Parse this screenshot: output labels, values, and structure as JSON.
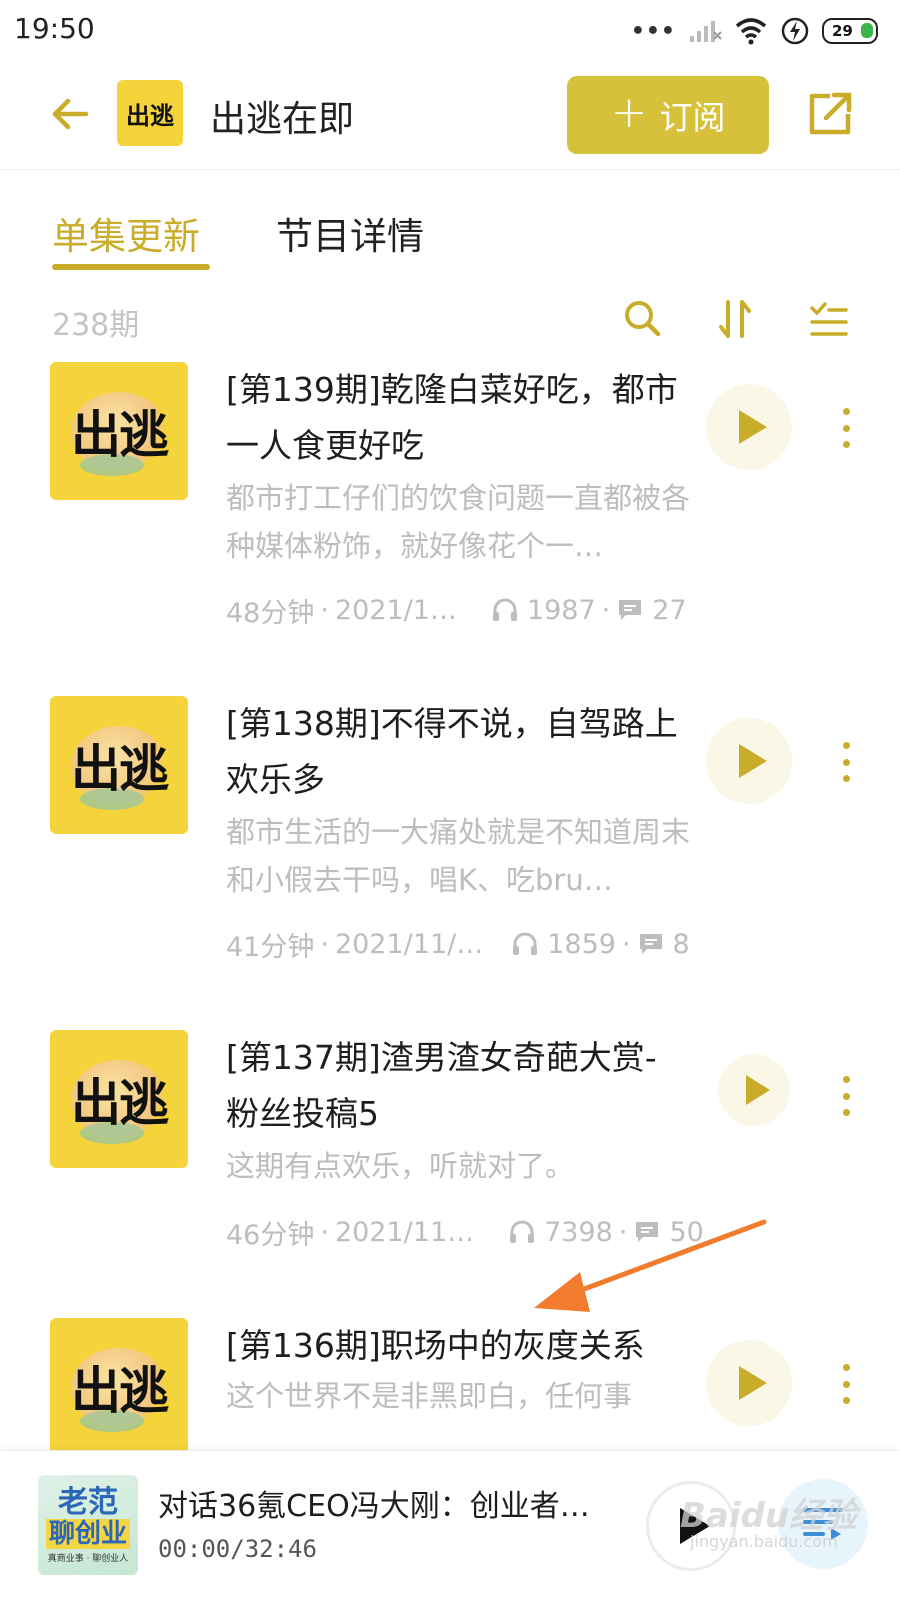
{
  "status_bar": {
    "time": "19:50",
    "signal_dots": "•••",
    "battery": "29"
  },
  "header": {
    "logo_text": "出逃",
    "title": "出逃在即",
    "subscribe_label": "订阅",
    "subscribe_plus": "+"
  },
  "tabs": [
    {
      "label": "单集更新",
      "active": true
    },
    {
      "label": "节目详情",
      "active": false
    }
  ],
  "toolbar": {
    "count": "238期"
  },
  "cover_text": "出逃",
  "episodes": [
    {
      "title": "[第139期]乾隆白菜好吃，都市一人食更好吃",
      "description": "都市打工仔们的饮食问题一直都被各种媒体粉饰，就好像花个一…",
      "duration": "48分钟",
      "date": "2021/1…",
      "plays": "1987",
      "comments": "27"
    },
    {
      "title": "[第138期]不得不说，自驾路上欢乐多",
      "description": "都市生活的一大痛处就是不知道周末和小假去干吗，唱K、吃bru…",
      "duration": "41分钟",
      "date": "2021/11/…",
      "plays": "1859",
      "comments": "8"
    },
    {
      "title": "[第137期]渣男渣女奇葩大赏-粉丝投稿5",
      "description": "这期有点欢乐，听就对了。",
      "duration": "46分钟",
      "date": "2021/11…",
      "plays": "7398",
      "comments": "50"
    },
    {
      "title": "[第136期]职场中的灰度关系",
      "description": "这个世界不是非黑即白，任何事"
    }
  ],
  "player": {
    "cover_line1": "老范",
    "cover_line2": "聊创业",
    "cover_line3": "真商业事 · 聊创业人",
    "title": "对话36氪CEO冯大刚：创业者…",
    "time": "00:00/32:46"
  },
  "watermark": {
    "main": "Baidu经验",
    "sub": "jingyan.baidu.com"
  },
  "colors": {
    "accent": "#c9ad2a",
    "subscribe_bg": "#d8c13a",
    "cover_bg": "#f5d33a",
    "annotation_arrow": "#f27b2e"
  }
}
